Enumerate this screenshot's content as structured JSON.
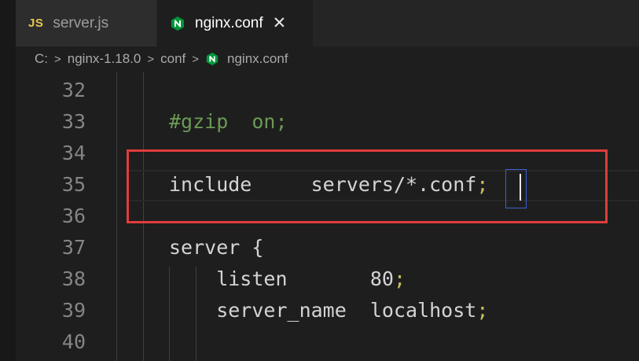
{
  "tabs": [
    {
      "icon": "js-icon",
      "icon_text": "JS",
      "label": "server.js",
      "active": false
    },
    {
      "icon": "nginx-icon",
      "label": "nginx.conf",
      "active": true,
      "close": "✕"
    }
  ],
  "breadcrumb": {
    "items": [
      "C:",
      "nginx-1.18.0",
      "conf",
      "nginx.conf"
    ],
    "separator": ">"
  },
  "editor": {
    "lines": [
      {
        "num": "32",
        "tokens": []
      },
      {
        "num": "33",
        "tokens": [
          {
            "t": "#gzip  on;",
            "c": "cmt"
          }
        ]
      },
      {
        "num": "34",
        "tokens": []
      },
      {
        "num": "35",
        "tokens": [
          {
            "t": "include     servers/*.conf",
            "c": "kw"
          },
          {
            "t": ";",
            "c": "punct"
          }
        ]
      },
      {
        "num": "36",
        "tokens": []
      },
      {
        "num": "37",
        "tokens": [
          {
            "t": "server {",
            "c": "kw"
          }
        ]
      },
      {
        "num": "38",
        "tokens": [
          {
            "t": "    listen       80",
            "c": "kw"
          },
          {
            "t": ";",
            "c": "punct"
          }
        ]
      },
      {
        "num": "39",
        "tokens": [
          {
            "t": "    server_name  localhost",
            "c": "kw"
          },
          {
            "t": ";",
            "c": "punct"
          }
        ]
      },
      {
        "num": "40",
        "tokens": []
      }
    ]
  },
  "colors": {
    "comment": "#6a9955",
    "text": "#d4d4d4",
    "punct": "#c8c060",
    "annotation": "#e03c3c",
    "nginx_green": "#009639"
  }
}
